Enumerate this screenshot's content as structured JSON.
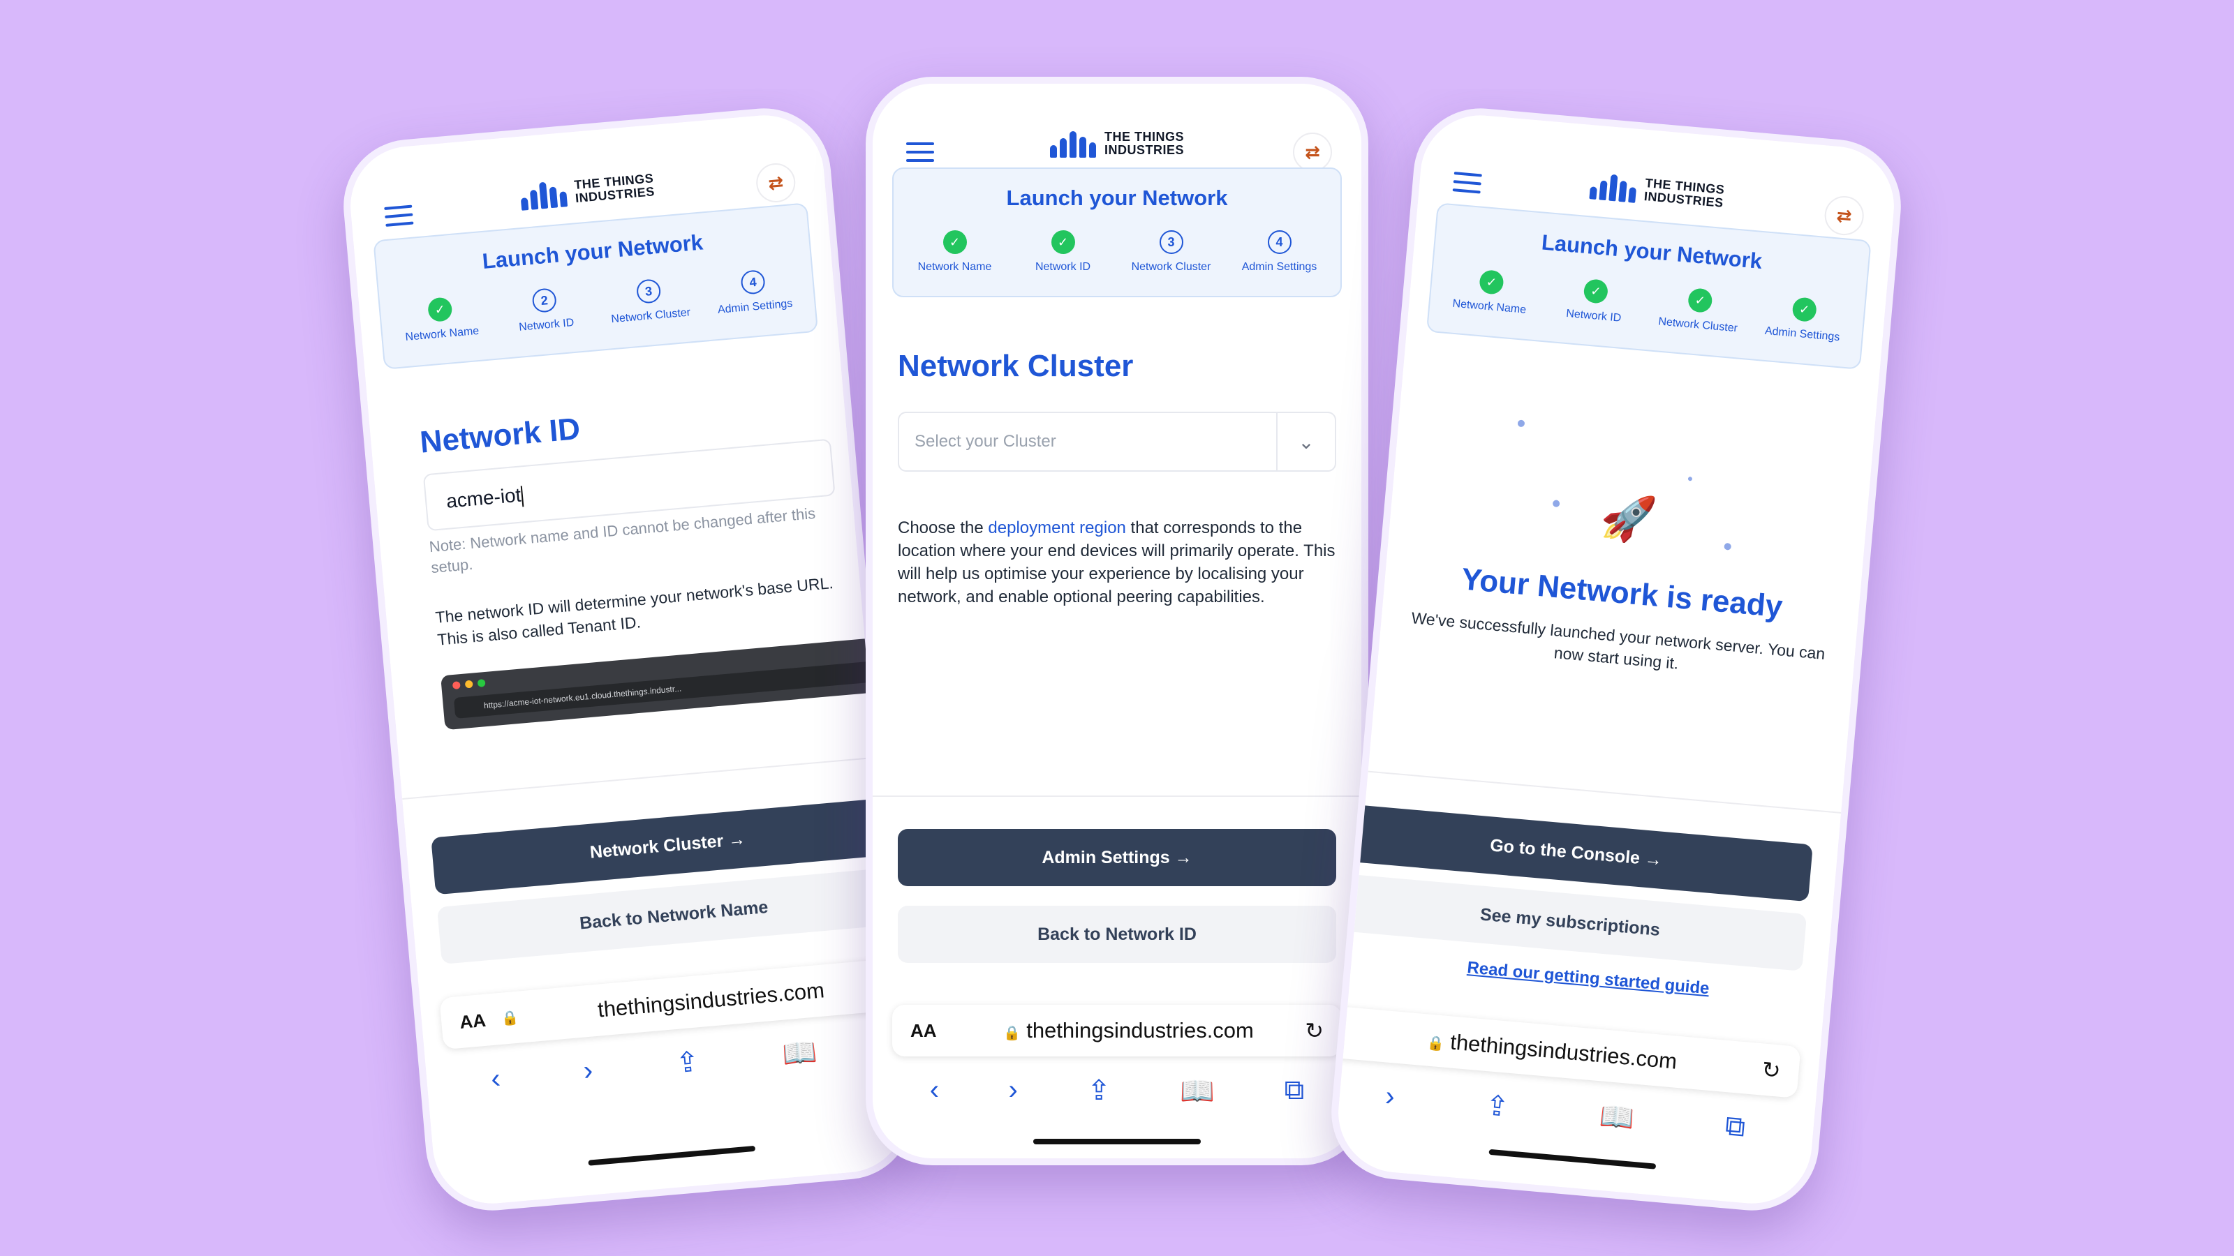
{
  "brand": {
    "wordmark_line1": "THE THINGS",
    "wordmark_line2": "INDUSTRIES"
  },
  "wizard": {
    "title": "Launch your Network",
    "steps": [
      {
        "label": "Network Name"
      },
      {
        "label": "Network ID"
      },
      {
        "label": "Network Cluster"
      },
      {
        "label": "Admin Settings"
      }
    ]
  },
  "left": {
    "steps_state": [
      "done",
      "2",
      "3",
      "4"
    ],
    "heading": "Network ID",
    "input_value": "acme-iot",
    "note": "Note: Network name and ID cannot be changed after this setup.",
    "description": "The network ID will determine your network's base URL. This is also called Tenant ID.",
    "preview_url": "https://acme-iot-network.eu1.cloud.thethings.industr...",
    "primary_button": "Network Cluster →",
    "secondary_button": "Back to Network Name",
    "address": "thethingsindustries.com"
  },
  "middle": {
    "steps_state": [
      "done",
      "done",
      "3",
      "4"
    ],
    "heading": "Network Cluster",
    "select_placeholder": "Select your Cluster",
    "para_pre": "Choose the ",
    "para_link": "deployment region",
    "para_post": " that corresponds to the location where your end devices will primarily operate. This will help us optimise your experience by localising your network, and enable optional peering capabilities.",
    "primary_button": "Admin Settings →",
    "secondary_button": "Back to Network ID",
    "address": "thethingsindustries.com"
  },
  "right": {
    "steps_state": [
      "done",
      "done",
      "done",
      "done"
    ],
    "heading": "Your Network is ready",
    "subtext": "We've successfully launched your network server. You can now start using it.",
    "primary_button": "Go to the Console →",
    "secondary_button": "See my subscriptions",
    "guide_link": "Read our getting started guide",
    "address": "thethingsindustries.com"
  },
  "browser": {
    "text_size_label": "AA"
  },
  "colors": {
    "background": "#d8b8fb",
    "accent": "#1f56d6",
    "button_dark": "#334159",
    "success": "#22c55e"
  }
}
